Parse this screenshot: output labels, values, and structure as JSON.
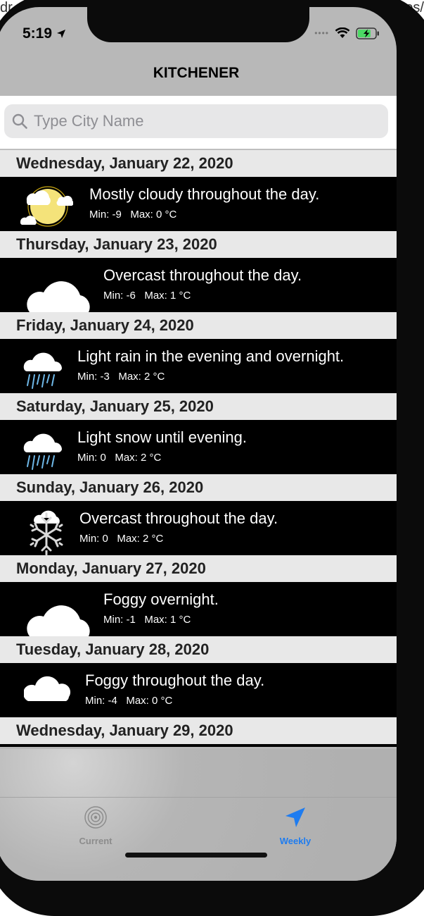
{
  "browser": {
    "left_fragment": "dr",
    "right_fragment": "es/"
  },
  "status_bar": {
    "time": "5:19"
  },
  "nav": {
    "title": "KITCHENER"
  },
  "search": {
    "placeholder": "Type City Name",
    "value": ""
  },
  "days": [
    {
      "date": "Wednesday, January 22, 2020",
      "icon": "partly-cloudy-day-icon",
      "summary": "Mostly cloudy throughout the day.",
      "temps": "Min: -9   Max: 0 °C"
    },
    {
      "date": "Thursday, January 23, 2020",
      "icon": "cloud-icon",
      "summary": "Overcast throughout the day.",
      "temps": "Min: -6   Max: 1 °C"
    },
    {
      "date": "Friday, January 24, 2020",
      "icon": "rain-icon",
      "summary": "Light rain in the evening and overnight.",
      "temps": "Min: -3   Max: 2 °C"
    },
    {
      "date": "Saturday, January 25, 2020",
      "icon": "rain-icon",
      "summary": "Light snow until evening.",
      "temps": "Min: 0   Max: 2 °C"
    },
    {
      "date": "Sunday, January 26, 2020",
      "icon": "snow-icon",
      "summary": "Overcast throughout the day.",
      "temps": "Min: 0   Max: 2 °C"
    },
    {
      "date": "Monday, January 27, 2020",
      "icon": "cloud-icon",
      "summary": "Foggy overnight.",
      "temps": "Min: -1   Max: 1 °C"
    },
    {
      "date": "Tuesday, January 28, 2020",
      "icon": "cloud-icon",
      "summary": "Foggy throughout the day.",
      "temps": "Min: -4   Max: 0 °C"
    },
    {
      "date": "Wednesday, January 29, 2020"
    }
  ],
  "tabs": {
    "current": {
      "label": "Current",
      "icon": "radar-icon"
    },
    "weekly": {
      "label": "Weekly",
      "icon": "location-arrow-icon",
      "selected": true
    }
  },
  "colors": {
    "accent": "#1e7cf0",
    "row_background": "#000000",
    "header_background": "#e8e8e8"
  }
}
